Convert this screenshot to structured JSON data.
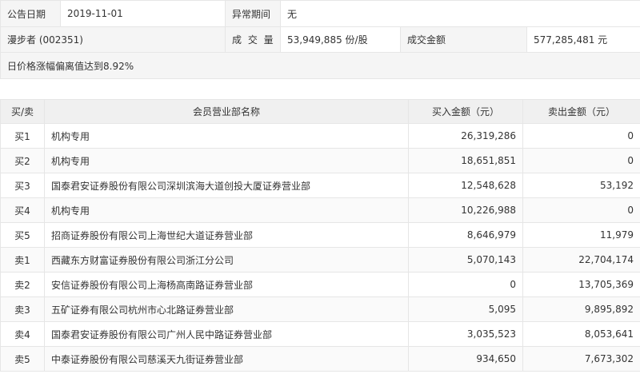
{
  "info": {
    "announce_date_label": "公告日期",
    "announce_date": "2019-11-01",
    "abnormal_period_label": "异常期间",
    "abnormal_period": "无",
    "stock": "漫步者 (002351)",
    "volume_label": "成 交 量",
    "volume": "53,949,885 份/股",
    "amount_label": "成交金额",
    "amount": "577,285,481 元",
    "reason": "日价格涨幅偏离值达到8.92%"
  },
  "table": {
    "headers": {
      "side": "买/卖",
      "member": "会员营业部名称",
      "buy": "买入金额（元）",
      "sell": "卖出金额（元）"
    },
    "rows": [
      {
        "side": "买1",
        "member": "机构专用",
        "buy": "26,319,286",
        "sell": "0"
      },
      {
        "side": "买2",
        "member": "机构专用",
        "buy": "18,651,851",
        "sell": "0"
      },
      {
        "side": "买3",
        "member": "国泰君安证券股份有限公司深圳滨海大道创投大厦证券营业部",
        "buy": "12,548,628",
        "sell": "53,192"
      },
      {
        "side": "买4",
        "member": "机构专用",
        "buy": "10,226,988",
        "sell": "0"
      },
      {
        "side": "买5",
        "member": "招商证券股份有限公司上海世纪大道证券营业部",
        "buy": "8,646,979",
        "sell": "11,979"
      },
      {
        "side": "卖1",
        "member": "西藏东方财富证券股份有限公司浙江分公司",
        "buy": "5,070,143",
        "sell": "22,704,174"
      },
      {
        "side": "卖2",
        "member": "安信证券股份有限公司上海杨高南路证券营业部",
        "buy": "0",
        "sell": "13,705,369"
      },
      {
        "side": "卖3",
        "member": "五矿证券有限公司杭州市心北路证券营业部",
        "buy": "5,095",
        "sell": "9,895,892"
      },
      {
        "side": "卖4",
        "member": "国泰君安证券股份有限公司广州人民中路证券营业部",
        "buy": "3,035,523",
        "sell": "8,053,641"
      },
      {
        "side": "卖5",
        "member": "中泰证券股份有限公司慈溪天九街证券营业部",
        "buy": "934,650",
        "sell": "7,673,302"
      }
    ]
  }
}
